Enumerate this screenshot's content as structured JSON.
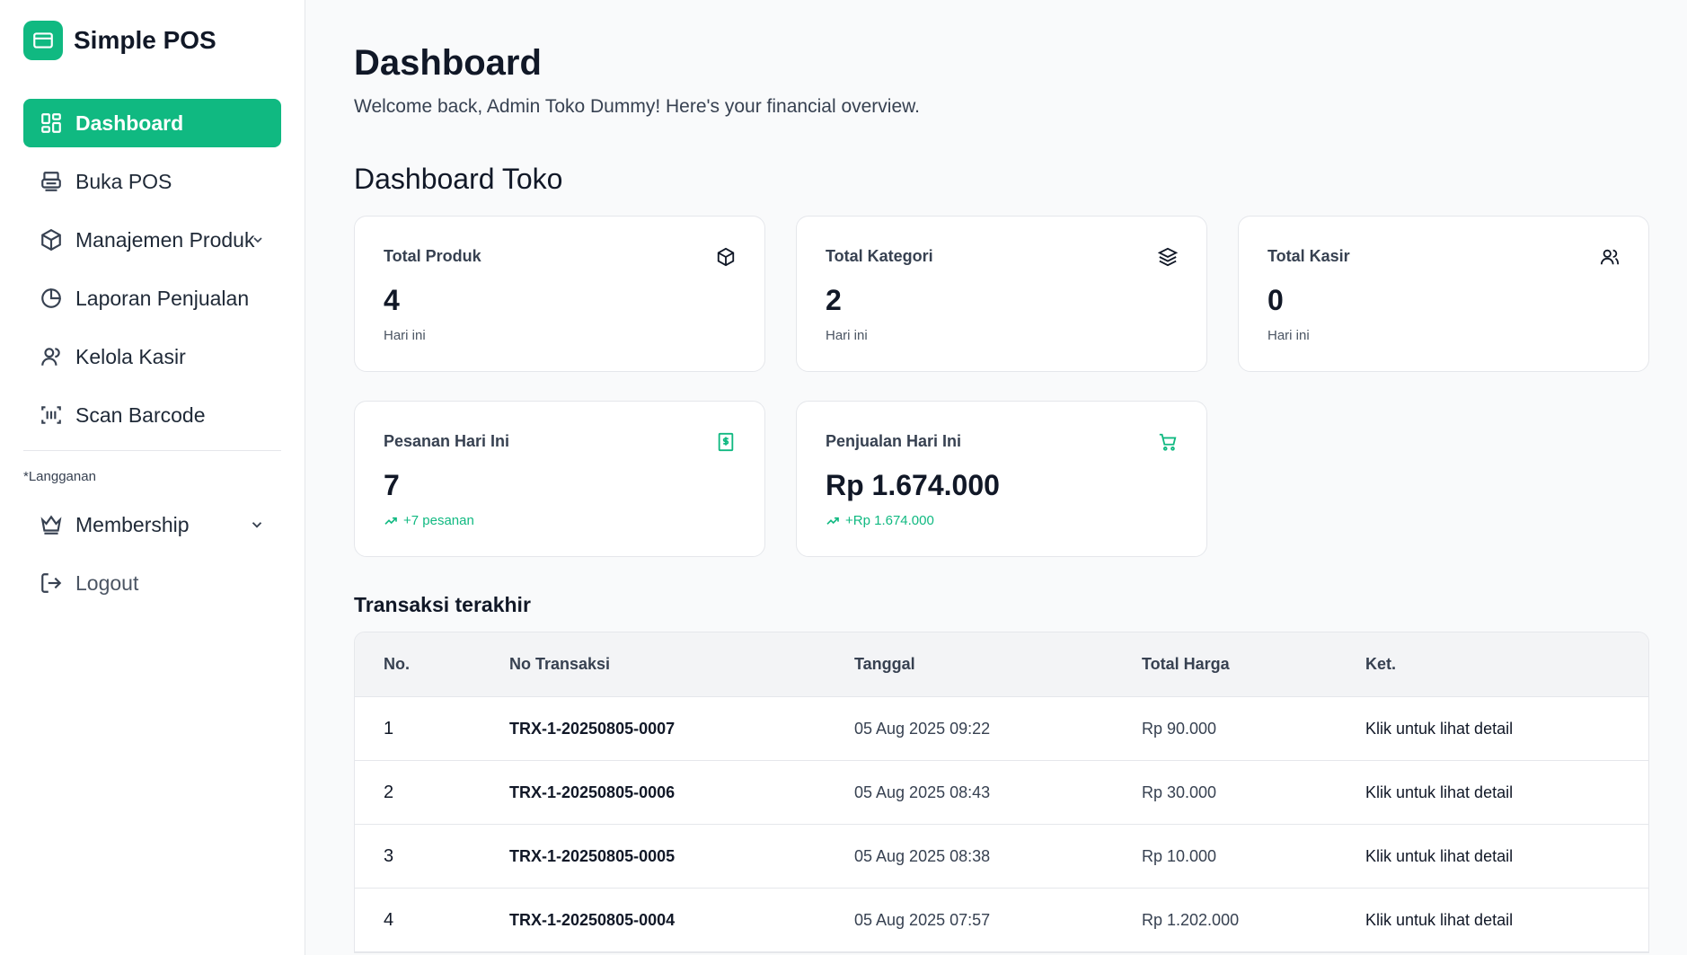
{
  "app": {
    "name": "Simple POS"
  },
  "sidebar": {
    "items": [
      {
        "label": "Dashboard",
        "icon": "grid-icon",
        "active": true
      },
      {
        "label": "Buka POS",
        "icon": "printer-icon"
      },
      {
        "label": "Manajemen Produk",
        "icon": "box-icon",
        "expandable": true
      },
      {
        "label": "Laporan Penjualan",
        "icon": "pie-chart-icon"
      },
      {
        "label": "Kelola Kasir",
        "icon": "user-icon"
      },
      {
        "label": "Scan Barcode",
        "icon": "barcode-scan-icon"
      }
    ],
    "section_label": "*Langganan",
    "sub_items": [
      {
        "label": "Membership",
        "icon": "crown-icon",
        "expandable": true
      },
      {
        "label": "Logout",
        "icon": "logout-icon"
      }
    ]
  },
  "header": {
    "title": "Dashboard",
    "subtitle": "Welcome back, Admin Toko Dummy! Here's your financial overview."
  },
  "section": {
    "title": "Dashboard Toko"
  },
  "cards": [
    {
      "label": "Total Produk",
      "value": "4",
      "foot": "Hari ini",
      "icon": "box-icon"
    },
    {
      "label": "Total Kategori",
      "value": "2",
      "foot": "Hari ini",
      "icon": "layers-icon"
    },
    {
      "label": "Total Kasir",
      "value": "0",
      "foot": "Hari ini",
      "icon": "users-icon"
    },
    {
      "label": "Pesanan Hari Ini",
      "value": "7",
      "foot": "+7 pesanan",
      "icon": "receipt-dollar-icon"
    },
    {
      "label": "Penjualan Hari Ini",
      "value": "Rp 1.674.000",
      "foot": "+Rp 1.674.000",
      "icon": "cart-icon"
    }
  ],
  "transactions": {
    "title": "Transaksi terakhir",
    "columns": [
      "No.",
      "No Transaksi",
      "Tanggal",
      "Total Harga",
      "Ket."
    ],
    "rows": [
      {
        "no": "1",
        "trx": "TRX-1-20250805-0007",
        "date": "05 Aug 2025 09:22",
        "total": "Rp 90.000",
        "ket": "Klik untuk lihat detail"
      },
      {
        "no": "2",
        "trx": "TRX-1-20250805-0006",
        "date": "05 Aug 2025 08:43",
        "total": "Rp 30.000",
        "ket": "Klik untuk lihat detail"
      },
      {
        "no": "3",
        "trx": "TRX-1-20250805-0005",
        "date": "05 Aug 2025 08:38",
        "total": "Rp 10.000",
        "ket": "Klik untuk lihat detail"
      },
      {
        "no": "4",
        "trx": "TRX-1-20250805-0004",
        "date": "05 Aug 2025 07:57",
        "total": "Rp 1.202.000",
        "ket": "Klik untuk lihat detail"
      }
    ]
  },
  "colors": {
    "accent": "#10b981",
    "text": "#111827",
    "muted": "#4b5563",
    "border": "#e5e7eb"
  }
}
